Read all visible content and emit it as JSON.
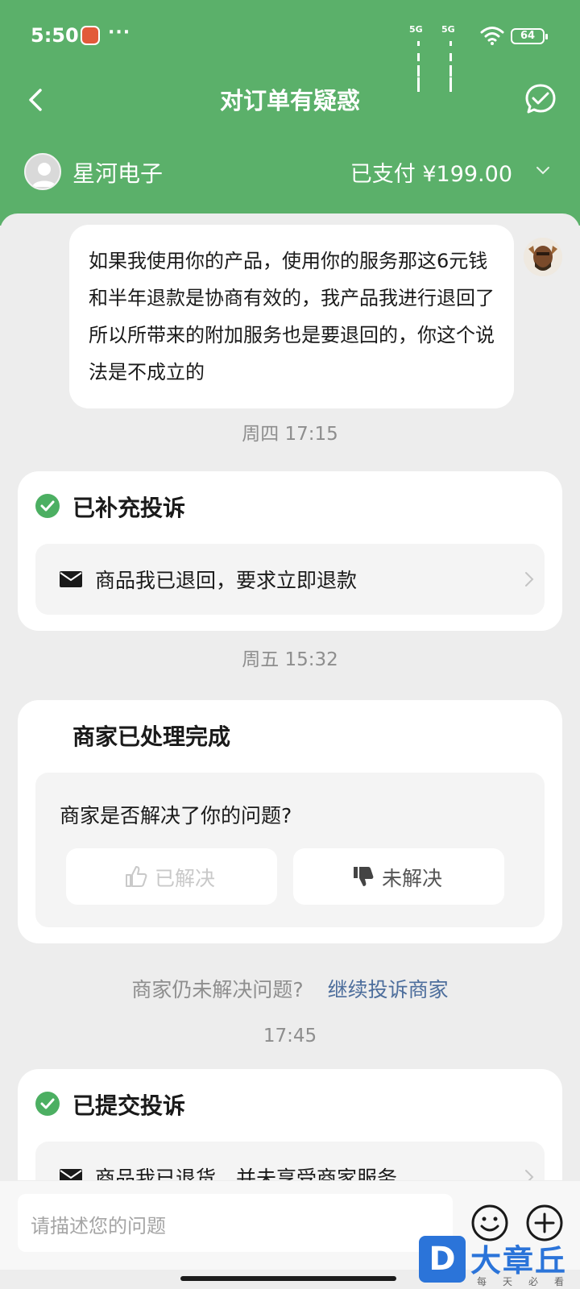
{
  "status_bar": {
    "time": "5:50",
    "dots": "···",
    "signal_1_label": "5G",
    "signal_2_label": "5G",
    "battery": "64"
  },
  "nav": {
    "title": "对订单有疑惑"
  },
  "order": {
    "merchant_name": "星河电子",
    "payment_status": "已支付 ¥199.00"
  },
  "messages": {
    "user_message": "如果我使用你的产品，使用你的服务那这6元钱和半年退款是协商有效的，我产品我进行退回了所以所带来的附加服务也是要退回的，你这个说法是不成立的",
    "timestamp_1": "周四 17:15",
    "card_1": {
      "title": "已补充投诉",
      "detail": "商品我已退回，要求立即退款"
    },
    "timestamp_2": "周五 15:32",
    "card_2": {
      "title": "商家已处理完成",
      "question": "商家是否解决了你的问题?",
      "resolved_label": "已解决",
      "unresolved_label": "未解决"
    },
    "followup_question": "商家仍未解决问题?",
    "followup_link": "继续投诉商家",
    "timestamp_3": "17:45",
    "card_3": {
      "title": "已提交投诉",
      "detail": "商品我已退货，并未享受商家服务"
    }
  },
  "input": {
    "placeholder": "请描述您的问题"
  },
  "watermark": {
    "logo_letter": "D",
    "name": "大章丘",
    "tagline": "每天必看"
  },
  "colors": {
    "header_green": "#5bb06a",
    "check_green": "#4caf62",
    "link_blue": "#4d6e9c"
  }
}
